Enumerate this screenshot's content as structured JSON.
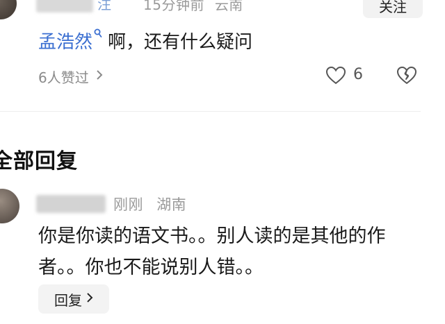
{
  "top_comment": {
    "name_tail": "注",
    "time": "15分钟前",
    "location": "云南",
    "follow_label": "关注"
  },
  "reply": {
    "mention_name": "孟浩然",
    "text": "啊，还有什么疑问",
    "likes_text": "6人赞过",
    "like_count": "6"
  },
  "section_title": "全部回复",
  "comment": {
    "time": "刚刚",
    "location": "湖南",
    "text": "你是你读的语文书。。别人读的是其他的作者。。你也不能说别人错。。",
    "reply_label": "回复"
  },
  "icons": {
    "heart": "heart-outline-icon",
    "dislike": "broken-heart-icon",
    "chevron": "chevron-right-icon",
    "search": "search-icon"
  },
  "colors": {
    "link_blue": "#3b6fd1",
    "meta_gray": "#9a9a9a"
  }
}
